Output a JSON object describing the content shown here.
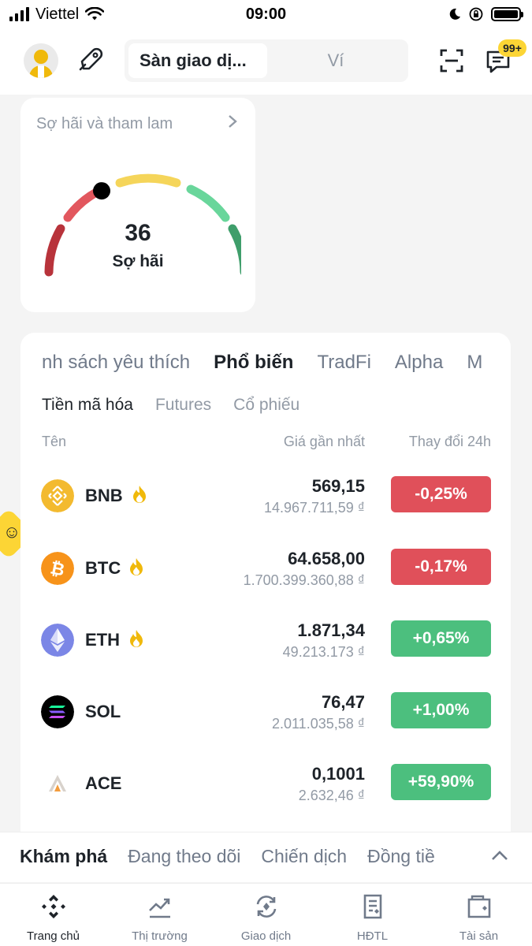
{
  "status_bar": {
    "carrier": "Viettel",
    "time": "09:00",
    "icons": [
      "signal-icon",
      "wifi-icon",
      "moon-icon",
      "rotation-lock-icon",
      "battery-icon"
    ]
  },
  "header": {
    "segment_tabs": [
      "Sàn giao dị...",
      "Ví"
    ],
    "active_segment": 0,
    "badge": "99+",
    "icons": [
      "avatar",
      "tag-icon",
      "scan-icon",
      "chat-icon"
    ]
  },
  "fear_greed": {
    "title": "Sợ hãi và tham lam",
    "value": "36",
    "label": "Sợ hãi",
    "gauge_level": 0.36
  },
  "market": {
    "tabs": [
      "nh sách yêu thích",
      "Phổ biến",
      "TradFi",
      "Alpha",
      "M"
    ],
    "active_tab": 1,
    "subtabs": [
      "Tiền mã hóa",
      "Futures",
      "Cổ phiếu"
    ],
    "active_subtab": 0,
    "columns": {
      "name": "Tên",
      "price": "Giá gần nhất",
      "change": "Thay đổi 24h"
    },
    "rows": [
      {
        "symbol": "BNB",
        "hot": true,
        "price": "569,15",
        "price_vnd": "14.967.711,59 ₫",
        "change": "-0,25%",
        "direction": "down",
        "icon": "bnb-icon"
      },
      {
        "symbol": "BTC",
        "hot": true,
        "price": "64.658,00",
        "price_vnd": "1.700.399.360,88 ₫",
        "change": "-0,17%",
        "direction": "down",
        "icon": "btc-icon"
      },
      {
        "symbol": "ETH",
        "hot": true,
        "price": "1.871,34",
        "price_vnd": "49.213.173 ₫",
        "change": "+0,65%",
        "direction": "up",
        "icon": "eth-icon"
      },
      {
        "symbol": "SOL",
        "hot": false,
        "price": "76,47",
        "price_vnd": "2.011.035,58 ₫",
        "change": "+1,00%",
        "direction": "up",
        "icon": "sol-icon"
      },
      {
        "symbol": "ACE",
        "hot": false,
        "price": "0,1001",
        "price_vnd": "2.632,46 ₫",
        "change": "+59,90%",
        "direction": "up",
        "icon": "ace-icon"
      }
    ]
  },
  "discover": {
    "tabs": [
      "Khám phá",
      "Đang theo dõi",
      "Chiến dịch",
      "Đồng tiề"
    ],
    "active": 0
  },
  "bottom_nav": {
    "items": [
      "Trang chủ",
      "Thị trường",
      "Giao dịch",
      "HĐTL",
      "Tài sản"
    ],
    "active": 0
  },
  "colors": {
    "brand_yellow": "#f0b90b",
    "negative": "#e0505a",
    "positive": "#4cbf7e"
  }
}
